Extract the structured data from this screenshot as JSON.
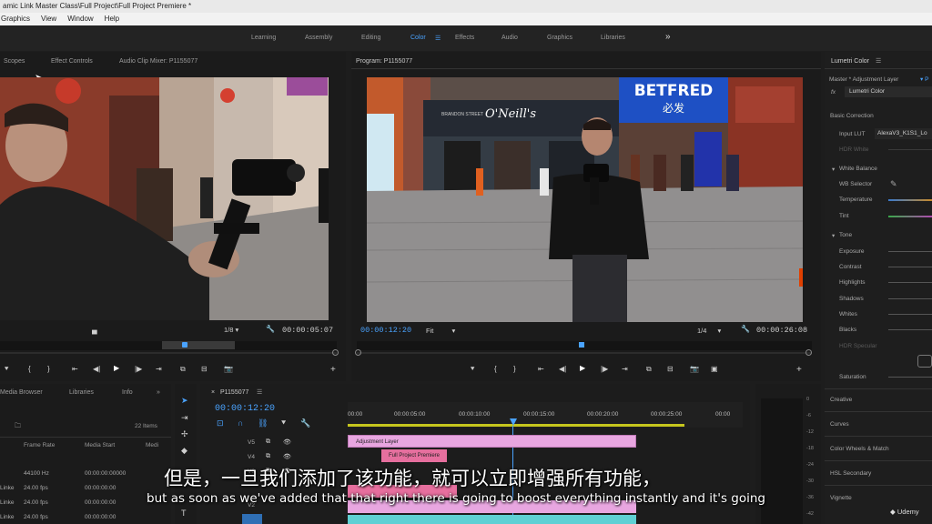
{
  "window": {
    "title": "amic Link Master Class\\Full Project\\Full Project Premiere *"
  },
  "menu": [
    "Graphics",
    "View",
    "Window",
    "Help"
  ],
  "workspaces": {
    "items": [
      "Learning",
      "Assembly",
      "Editing",
      "Color",
      "Effects",
      "Audio",
      "Graphics",
      "Libraries"
    ],
    "active": "Color",
    "more": "»"
  },
  "source_panel": {
    "tabs": [
      "Scopes",
      "Effect Controls",
      "Audio Clip Mixer: P1155077"
    ],
    "scale": "1/8",
    "timecode": "00:00:05:07"
  },
  "program_panel": {
    "title": "Program: P1155077",
    "current_timecode": "00:00:12:20",
    "fit": "Fit",
    "scale": "1/4",
    "duration": "00:00:26:08"
  },
  "scene_signs": {
    "betfred": "BETFRED",
    "betfred_sub": "必发",
    "oneills": "O'Neill's",
    "street": "BRANDON STREET"
  },
  "lumetri": {
    "title": "Lumetri Color",
    "master": "Master * Adjustment Layer",
    "fx_label": "Lumetri Color",
    "basic_correction": "Basic Correction",
    "input_lut_label": "Input LUT",
    "input_lut_value": "AlexaV3_K1S1_Lo",
    "hdr_white": "HDR White",
    "white_balance": "White Balance",
    "wb_selector": "WB Selector",
    "temperature": "Temperature",
    "tint": "Tint",
    "tone": "Tone",
    "tone_items": [
      "Exposure",
      "Contrast",
      "Highlights",
      "Shadows",
      "Whites",
      "Blacks"
    ],
    "hdr_specular": "HDR Specular",
    "saturation": "Saturation",
    "sections": [
      "Creative",
      "Curves",
      "Color Wheels & Match",
      "HSL Secondary",
      "Vignette"
    ]
  },
  "project_panel": {
    "tabs": [
      "Media Browser",
      "Libraries",
      "Info"
    ],
    "items_count": "22 Items",
    "columns": [
      "Frame Rate",
      "Media Start",
      "Medi"
    ],
    "rows": [
      {
        "name": "",
        "fps": "44100 Hz",
        "start": "00:00:00:00000"
      },
      {
        "name": "Linke",
        "fps": "24.00 fps",
        "start": "00:00:00:00"
      },
      {
        "name": "Linke",
        "fps": "24.00 fps",
        "start": "00:00:00:00"
      },
      {
        "name": "Linke",
        "fps": "24.00 fps",
        "start": "00:00:00:00"
      }
    ]
  },
  "timeline": {
    "tab": "P1155077",
    "timecode": "00:00:12:20",
    "ruler": [
      "00:00",
      "00:00:05:00",
      "00:00:10:00",
      "00:00:15:00",
      "00:00:20:00",
      "00:00:25:00",
      "00:00"
    ],
    "tracks": [
      "V5",
      "V4",
      "V3",
      "V2",
      "V1"
    ],
    "clips": {
      "adjustment": "Adjustment Layer",
      "premiere": "Full Project Premiere"
    }
  },
  "meter_scale": [
    "0",
    "-6",
    "-12",
    "-18",
    "-24",
    "-30",
    "-36",
    "-42"
  ],
  "subtitles": {
    "zh": "但是，一旦我们添加了该功能，就可以立即增强所有功能，",
    "en": "but as soon as we've added that that right there is going to boost everything instantly and it's going"
  },
  "watermark": "Udemy"
}
